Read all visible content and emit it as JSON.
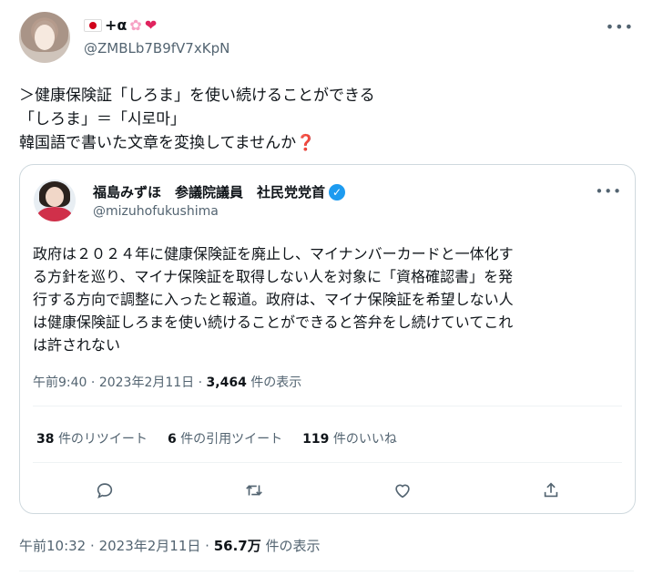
{
  "author": {
    "display_name_text": "+α",
    "handle": "@ZMBLb7B9fV7xKpN",
    "flag_icon": "japan-flag-icon",
    "flower_icon": "cherry-blossom-icon",
    "heart_icon": "two-hearts-icon"
  },
  "tweet": {
    "lines": [
      "＞健康保険証「しろま」を使い続けることができる",
      "「しろま」＝「시로마」",
      "韓国語で書いた文章を変換してませんか"
    ],
    "emoji_icon": "red-question-mark-icon",
    "emoji": "❓",
    "time": "午前10:32",
    "date": "2023年2月11日",
    "views": "56.7万",
    "views_label": "件の表示",
    "separator": "·"
  },
  "quote": {
    "name": "福島みずほ　参議院議員　社民党党首",
    "handle": "@mizuhofukushima",
    "verified_icon": "verified-badge-icon",
    "body_lines": [
      "政府は２０２４年に健康保険証を廃止し、マイナンバーカードと一体化す",
      "る方針を巡り、マイナ保険証を取得しない人を対象に「資格確認書」を発",
      "行する方向で調整に入ったと報道。政府は、マイナ保険証を希望しない人",
      "は健康保険証しろまを使い続けることができると答弁をし続けていてこれ",
      "は許されない"
    ],
    "time": "午前9:40",
    "date": "2023年2月11日",
    "views": "3,464",
    "views_label": "件の表示",
    "separator": "·",
    "retweets_count": "38",
    "retweets_label": "件のリツイート",
    "quotes_count": "6",
    "quotes_label": "件の引用ツイート",
    "likes_count": "119",
    "likes_label": "件のいいね",
    "actions": [
      "reply-icon",
      "retweet-icon",
      "like-icon",
      "share-icon"
    ]
  },
  "colors": {
    "text": "#0f1419",
    "secondary": "#536471",
    "border": "#cfd9de",
    "verified": "#1d9bf0",
    "question_mark": "#be1931"
  }
}
